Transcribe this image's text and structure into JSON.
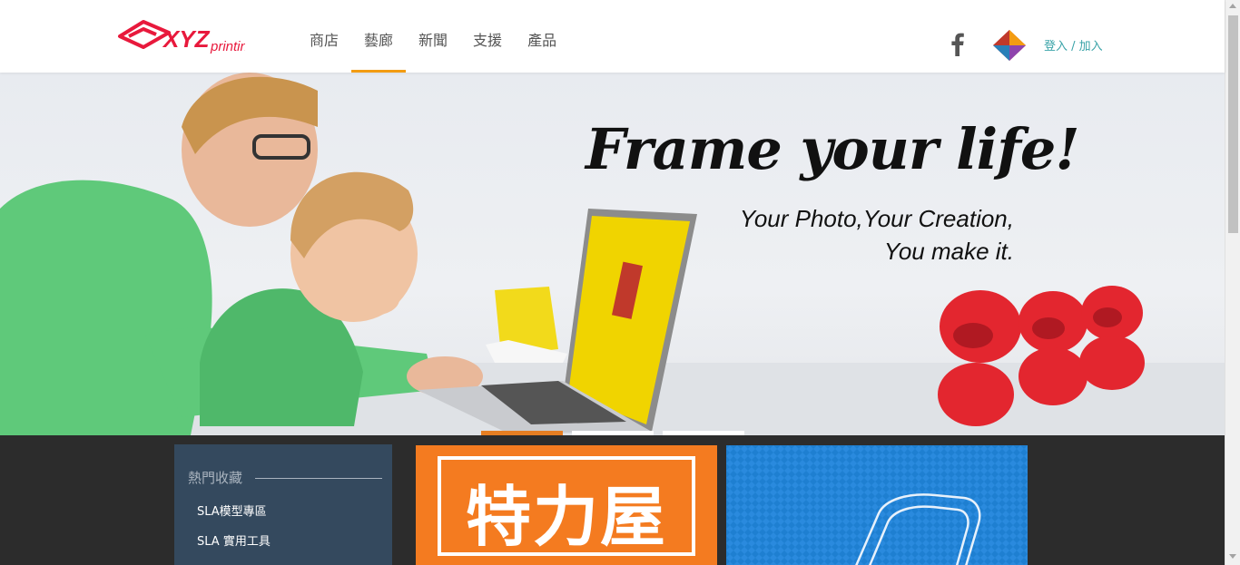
{
  "header": {
    "logo_text": "XYZprinting",
    "nav": [
      {
        "label": "商店",
        "active": false
      },
      {
        "label": "藝廊",
        "active": true
      },
      {
        "label": "新聞",
        "active": false
      },
      {
        "label": "支援",
        "active": false
      },
      {
        "label": "產品",
        "active": false
      }
    ],
    "login_label": "登入 / 加入",
    "accent_color": "#f39c12",
    "link_color": "#3aa3a8"
  },
  "hero": {
    "headline": "Frame your life!",
    "sub_line_1": "Your Photo,Your Creation,",
    "sub_line_2": "You make it.",
    "slides_total": 3,
    "active_slide": 1
  },
  "sidebar": {
    "title": "熱門收藏",
    "links": [
      "SLA模型專區",
      "SLA 實用工具"
    ]
  },
  "promo": {
    "orange_card_text": "特力屋",
    "orange_color": "#f47b20",
    "blue_color": "#1e7fd1"
  }
}
